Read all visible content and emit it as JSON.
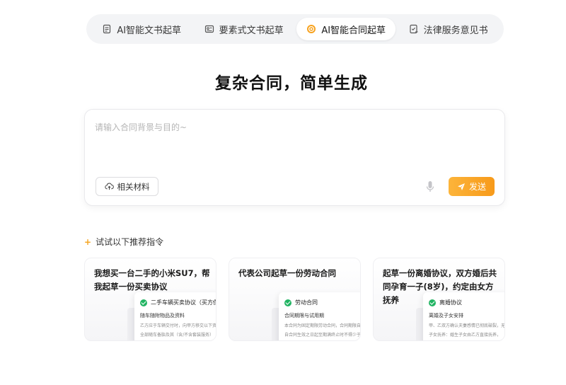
{
  "tabs": [
    {
      "label": "AI智能文书起草",
      "icon": "document-icon",
      "active": false
    },
    {
      "label": "要素式文书起草",
      "icon": "id-card-icon",
      "active": false
    },
    {
      "label": "AI智能合同起草",
      "icon": "contract-ai-icon",
      "active": true
    },
    {
      "label": "法律服务意见书",
      "icon": "opinion-doc-icon",
      "active": false
    }
  ],
  "headline": "复杂合同，简单生成",
  "input": {
    "placeholder": "请输入合同背景与目的~",
    "value": "",
    "material_label": "相关材料",
    "send_label": "发送"
  },
  "suggestions": {
    "heading": "试试以下推荐指令",
    "cards": [
      {
        "title": "我想买一台二手的小米SU7，帮我起草一份买卖协议",
        "doc_title": "二手车辆买卖协议（买方保",
        "doc_sub": "随车随附物品及资料",
        "doc_lines": [
          "乙方应于车辆交付时，向甲方移交以下资",
          "全部随车备胎及其（含/不含套装服务）"
        ]
      },
      {
        "title": "代表公司起草一份劳动合同",
        "doc_title": "劳动合同",
        "doc_sub": "合同期限与试用期",
        "doc_lines": [
          "本合同为固定期限劳动合同，合同期限自",
          "自合同生效之日起至期满终止时不得少于"
        ]
      },
      {
        "title": "起草一份离婚协议，双方婚后共同孕育一子(8岁)，约定由女方抚养",
        "doc_title": "离婚协议",
        "doc_sub": "离婚及子女安排",
        "doc_lines": [
          "甲、乙双方确认夫妻感情已彻底破裂，无",
          "子女抚养：婚生子女由乙方直接抚养，"
        ]
      }
    ]
  },
  "colors": {
    "accent_orange": "#f79a1a",
    "check_green": "#22b463",
    "tab_bg": "#f3f4f6"
  }
}
